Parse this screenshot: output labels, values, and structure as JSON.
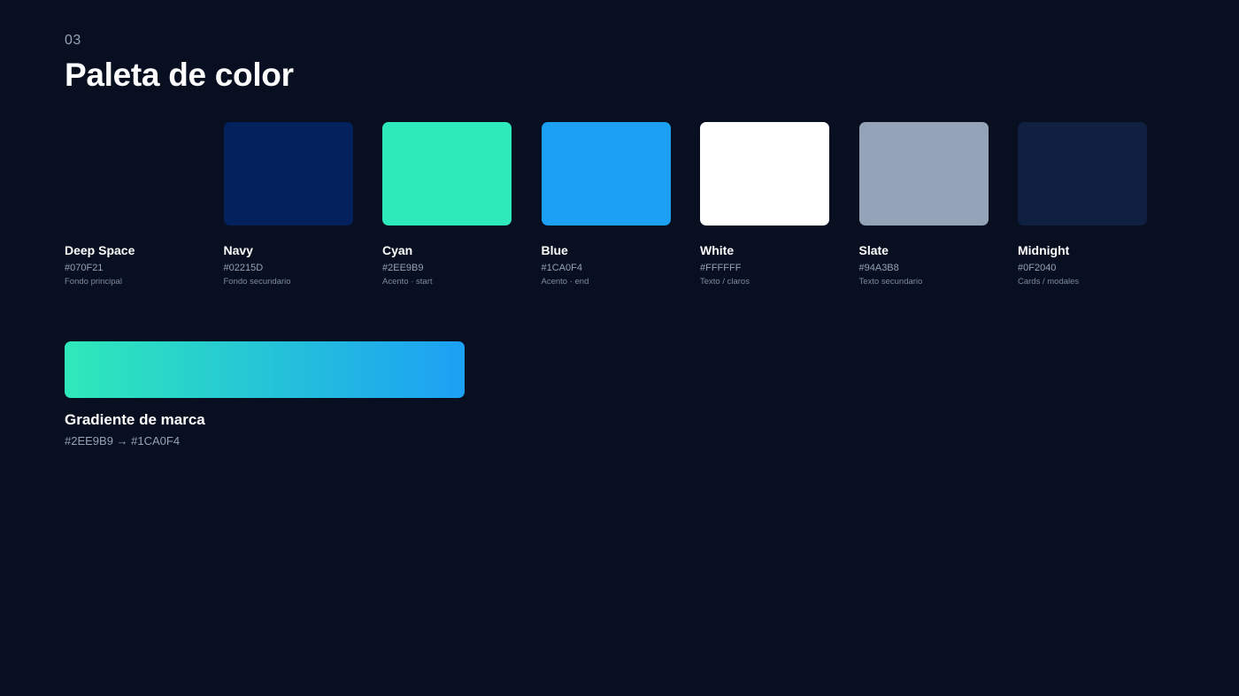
{
  "section": {
    "number": "03",
    "title": "Paleta de color"
  },
  "palette": [
    {
      "name": "Deep Space",
      "hex": "#070F21",
      "usage": "Fondo principal",
      "color": "#070F21"
    },
    {
      "name": "Navy",
      "hex": "#02215D",
      "usage": "Fondo secundario",
      "color": "#02215D"
    },
    {
      "name": "Cyan",
      "hex": "#2EE9B9",
      "usage": "Acento · start",
      "color": "#2EE9B9"
    },
    {
      "name": "Blue",
      "hex": "#1CA0F4",
      "usage": "Acento · end",
      "color": "#1CA0F4"
    },
    {
      "name": "White",
      "hex": "#FFFFFF",
      "usage": "Texto / claros",
      "color": "#FFFFFF"
    },
    {
      "name": "Slate",
      "hex": "#94A3B8",
      "usage": "Texto secundario",
      "color": "#94A3B8"
    },
    {
      "name": "Midnight",
      "hex": "#0F2040",
      "usage": "Cards / modales",
      "color": "#0F2040"
    }
  ],
  "gradient": {
    "name": "Gradiente de marca",
    "stops_label": "#2EE9B9 → #1CA0F4",
    "start_color": "#2EE9B9",
    "end_color": "#1CA0F4"
  }
}
